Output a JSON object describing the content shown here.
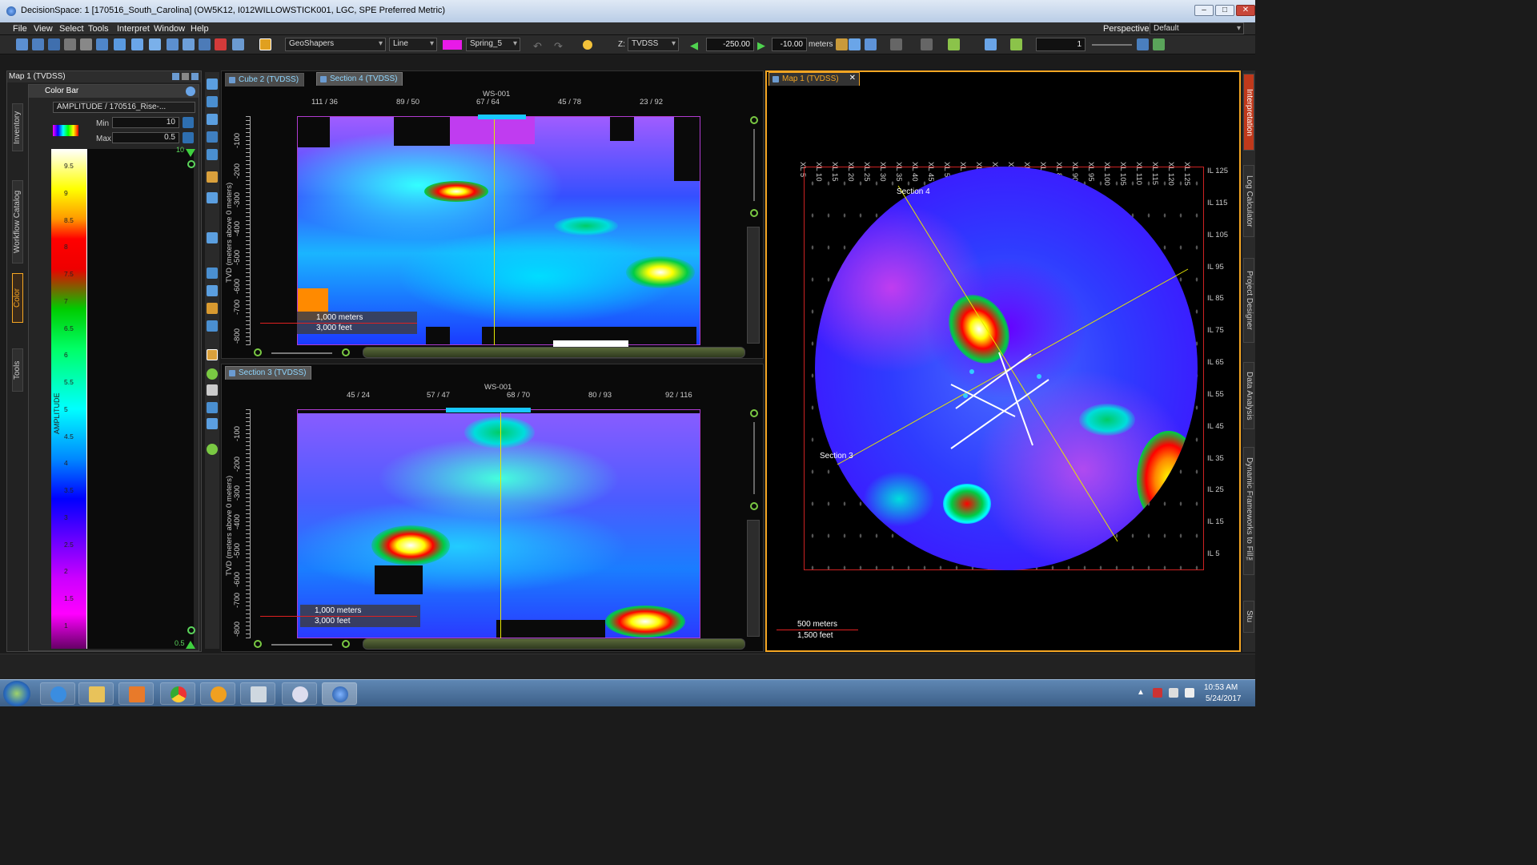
{
  "window": {
    "title": "DecisionSpace: 1 [170516_South_Carolina] (OW5K12, I012WILLOWSTICK001, LGC, SPE Preferred Metric)",
    "min_label": "–",
    "max_label": "□",
    "close_label": "✕"
  },
  "menu": [
    "File",
    "View",
    "Select",
    "Tools",
    "Interpret",
    "Window",
    "Help"
  ],
  "toolbar": {
    "layer_dropdown": "GeoShapers",
    "style_dropdown": "Line",
    "color_map_dropdown": "Spring_5",
    "domain_label": "Z:",
    "domain_dropdown": "TVDSS",
    "depth_value_1": "-250.00",
    "depth_value_2": "-10.00",
    "depth_unit": "meters",
    "count_value": "1",
    "perspective_label": "Perspective:",
    "perspective_value": "Default",
    "accent_color": "#e81ae8"
  },
  "left_panel": {
    "header": "Map 1 (TVDSS)",
    "vtabs": [
      "Inventory",
      "Workflow Catalog",
      "Color",
      "Tools"
    ],
    "colorbar": {
      "title": "Color Bar",
      "attribute": "AMPLITUDE / 170516_Rise-...",
      "min_label": "Min",
      "min_value": "10",
      "max_label": "Max",
      "max_value": "0.5",
      "top_tick": "10",
      "bottom_tick": "0.5",
      "axis_label": "AMPLITUDE",
      "scale_ticks": [
        "9.5",
        "9",
        "8.5",
        "8",
        "7.5",
        "7",
        "6.5",
        "6",
        "5.5",
        "5",
        "4.5",
        "4",
        "3.5",
        "3",
        "2.5",
        "2",
        "1.5",
        "1"
      ]
    }
  },
  "cube_panel": {
    "tabs": [
      {
        "label": "Cube 2 (TVDSS)",
        "selected": false
      },
      {
        "label": "Section 4 (TVDSS)",
        "selected": true
      }
    ],
    "well_label": "WS-001",
    "x_ticks": [
      "111 / 36",
      "89 / 50",
      "67 / 64",
      "45 / 78",
      "23 / 92"
    ],
    "y_label": "TVD (meters above 0 meters)",
    "y_ticks": [
      "-100",
      "-200",
      "-300",
      "-400",
      "-500",
      "-600",
      "-700",
      "-800"
    ],
    "scale_meters": "1,000 meters",
    "scale_feet": "3,000 feet"
  },
  "section3_panel": {
    "tab": "Section 3 (TVDSS)",
    "well_label": "WS-001",
    "x_ticks": [
      "45 / 24",
      "57 / 47",
      "68 / 70",
      "80 / 93",
      "92 / 116"
    ],
    "y_label": "TVD (meters above 0 meters)",
    "y_ticks": [
      "-100",
      "-200",
      "-300",
      "-400",
      "-500",
      "-600",
      "-700",
      "-800"
    ],
    "scale_meters": "1,000 meters",
    "scale_feet": "3,000 feet"
  },
  "map_panel": {
    "tab": "Map 1 (TVDSS)",
    "xl_ticks": [
      "XL 5",
      "XL 10",
      "XL 15",
      "XL 20",
      "XL 25",
      "XL 30",
      "XL 35",
      "XL 40",
      "XL 45",
      "XL 50",
      "XL 55",
      "XL 60",
      "XL 65",
      "XL 70",
      "XL 75",
      "XL 80",
      "XL 85",
      "XL 90",
      "XL 95",
      "XL 100",
      "XL 105",
      "XL 110",
      "XL 115",
      "XL 120",
      "XL 125"
    ],
    "il_ticks": [
      "IL 125",
      "IL 115",
      "IL 105",
      "IL 95",
      "IL 85",
      "IL 75",
      "IL 65",
      "IL 55",
      "IL 45",
      "IL 35",
      "IL 25",
      "IL 15",
      "IL 5"
    ],
    "section4_label": "Section 4",
    "section3_label": "Section 3",
    "scale_meters": "500 meters",
    "scale_feet": "1,500 feet"
  },
  "right_vtabs": [
    "Interpretation",
    "Log Calculator",
    "Project Designer",
    "Data Analysis",
    "Dynamic Frameworks to Fill™",
    "Stu"
  ],
  "taskbar": {
    "time": "10:53 AM",
    "date": "5/24/2017"
  }
}
